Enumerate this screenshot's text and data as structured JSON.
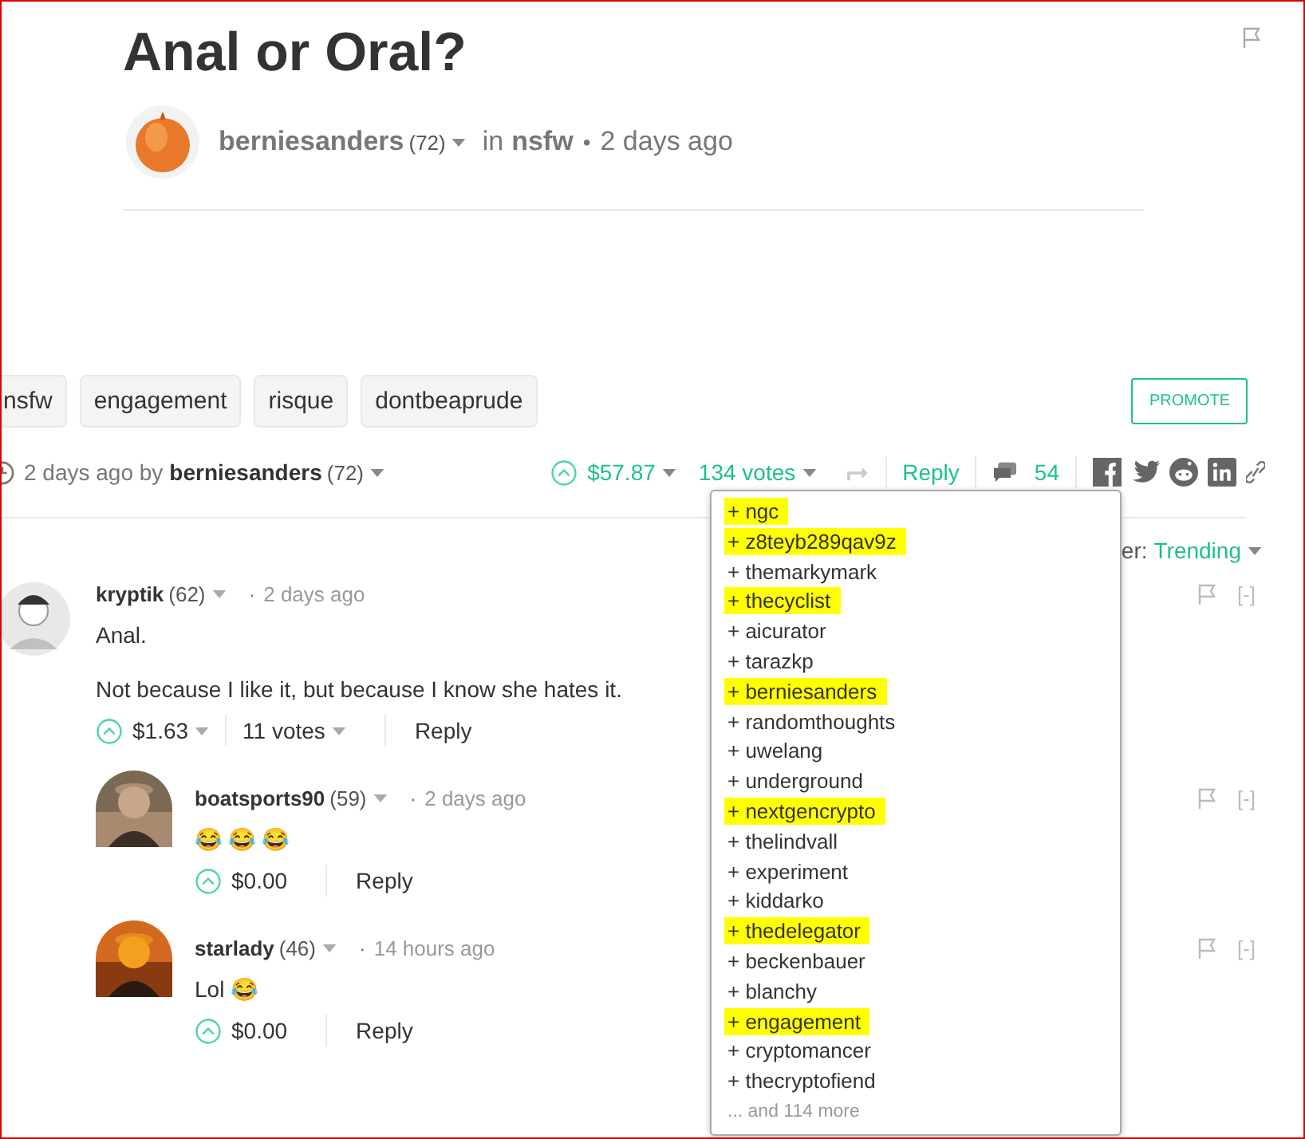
{
  "post": {
    "title": "Anal or Oral?",
    "author": "berniesanders",
    "reputation": "(72)",
    "in_label": "in",
    "category": "nsfw",
    "separator": "•",
    "time": "2 days ago"
  },
  "tags": [
    "nsfw",
    "engagement",
    "risque",
    "dontbeaprude"
  ],
  "promote_button": "PROMOTE",
  "footer": {
    "time_by": "2 days ago by",
    "author": "berniesanders",
    "reputation": "(72)",
    "payout": "$57.87",
    "votes": "134 votes",
    "reply": "Reply",
    "comment_count": "54"
  },
  "sort": {
    "label": "er:",
    "value": "Trending"
  },
  "comments": [
    {
      "author": "kryptik",
      "reputation": "(62)",
      "separator": "·",
      "time": "2 days ago",
      "paragraphs": [
        "Anal.",
        "Not because I like it, but because I know she hates it."
      ],
      "payout": "$1.63",
      "votes": "11 votes",
      "reply": "Reply",
      "collapse": "[-]",
      "children": [
        {
          "author": "boatsports90",
          "reputation": "(59)",
          "separator": "·",
          "time": "2 days ago",
          "paragraphs": [
            "😂 😂 😂"
          ],
          "payout": "$0.00",
          "reply": "Reply",
          "collapse": "[-]"
        },
        {
          "author": "starlady",
          "reputation": "(46)",
          "separator": "·",
          "time": "14 hours ago",
          "paragraphs": [
            "Lol 😂"
          ],
          "payout": "$0.00",
          "reply": "Reply",
          "collapse": "[-]"
        }
      ]
    }
  ],
  "voters": [
    {
      "name": "+ ngc",
      "highlighted": true
    },
    {
      "name": "+ z8teyb289qav9z",
      "highlighted": true
    },
    {
      "name": "+ themarkymark",
      "highlighted": false
    },
    {
      "name": "+ thecyclist",
      "highlighted": true
    },
    {
      "name": "+ aicurator",
      "highlighted": false
    },
    {
      "name": "+ tarazkp",
      "highlighted": false
    },
    {
      "name": "+ berniesanders",
      "highlighted": true
    },
    {
      "name": "+ randomthoughts",
      "highlighted": false
    },
    {
      "name": "+ uwelang",
      "highlighted": false
    },
    {
      "name": "+ underground",
      "highlighted": false
    },
    {
      "name": "+ nextgencrypto",
      "highlighted": true
    },
    {
      "name": "+ thelindvall",
      "highlighted": false
    },
    {
      "name": "+ experiment",
      "highlighted": false
    },
    {
      "name": "+ kiddarko",
      "highlighted": false
    },
    {
      "name": "+ thedelegator",
      "highlighted": true
    },
    {
      "name": "+ beckenbauer",
      "highlighted": false
    },
    {
      "name": "+ blanchy",
      "highlighted": false
    },
    {
      "name": "+ engagement",
      "highlighted": true
    },
    {
      "name": "+ cryptomancer",
      "highlighted": false
    },
    {
      "name": "+ thecryptofiend",
      "highlighted": false
    }
  ],
  "voters_more": "... and 114 more"
}
